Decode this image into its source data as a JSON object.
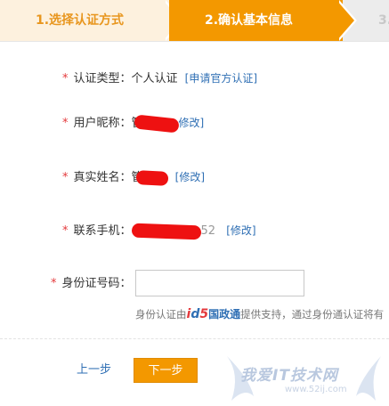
{
  "steps": [
    {
      "label": "1.选择认证方式"
    },
    {
      "label": "2.确认基本信息"
    },
    {
      "label": "3."
    }
  ],
  "form": {
    "required_mark": "*",
    "type_label": "认证类型：",
    "type_value": "个人认证",
    "type_link": "[申请官方认证]",
    "nickname_label": "用户昵称：",
    "nickname_value_visible": "管",
    "nickname_link": "修改]",
    "realname_label": "真实姓名：",
    "realname_value_visible": "管",
    "realname_link": "[修改]",
    "phone_label": "联系手机：",
    "phone_value_visible": "52",
    "phone_link": "[修改]",
    "id_label": "身份证号码：",
    "id_value": "",
    "hint_prefix": "身份认证由",
    "hint_logo": {
      "i": "i",
      "d": "d",
      "five": "5",
      "guo": "国政通"
    },
    "hint_suffix": "提供支持，通过身份通认证将有"
  },
  "actions": {
    "prev_label": "上一步",
    "next_label": "下一步"
  },
  "watermark": {
    "text": "我爱IT技术网",
    "url": "www.52ij.com"
  },
  "colors": {
    "accent": "#f39800",
    "link": "#2f6fb4",
    "required": "#e4393c"
  }
}
